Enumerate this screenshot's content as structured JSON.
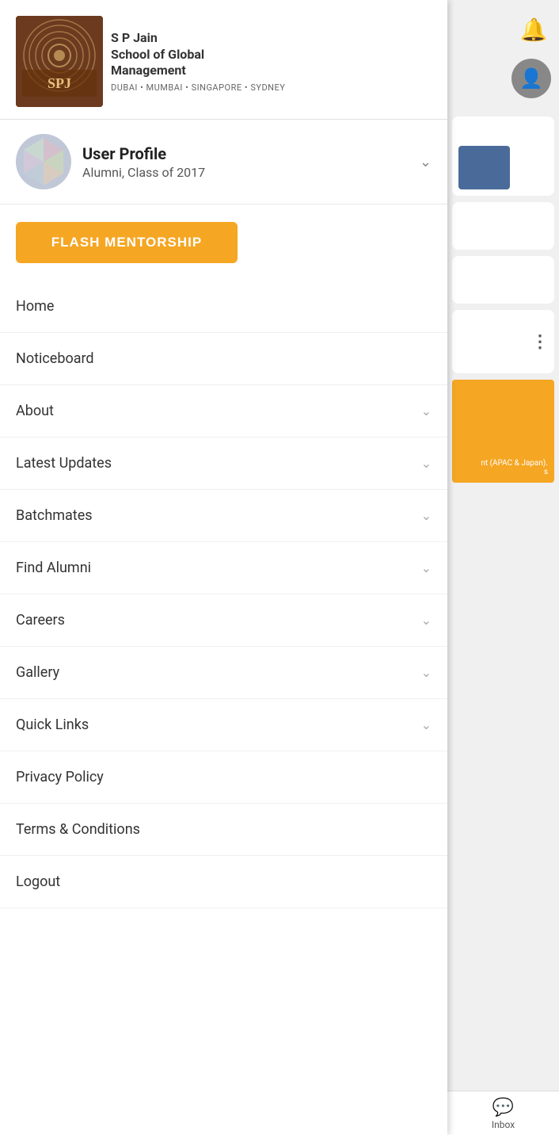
{
  "drawer": {
    "logo": {
      "school_name": "S P Jain",
      "school_sub": "School of Global",
      "school_sub2": "Management",
      "cities": "DUBAI • MUMBAI • SINGAPORE • SYDNEY",
      "spj_text": "SPJ"
    },
    "user_profile": {
      "name": "User Profile",
      "role": "Alumni, Class of 2017",
      "chevron": "›"
    },
    "flash_mentorship_btn": "FLASH MENTORSHIP",
    "nav_items": [
      {
        "label": "Home",
        "has_chevron": false
      },
      {
        "label": "Noticeboard",
        "has_chevron": false
      },
      {
        "label": "About",
        "has_chevron": true
      },
      {
        "label": "Latest Updates",
        "has_chevron": true
      },
      {
        "label": "Batchmates",
        "has_chevron": true
      },
      {
        "label": "Find Alumni",
        "has_chevron": true
      },
      {
        "label": "Careers",
        "has_chevron": true
      },
      {
        "label": "Gallery",
        "has_chevron": true
      },
      {
        "label": "Quick Links",
        "has_chevron": true
      }
    ],
    "bottom_links": [
      {
        "label": "Privacy Policy"
      },
      {
        "label": "Terms & Conditions"
      },
      {
        "label": "Logout"
      }
    ]
  },
  "right_panel": {
    "bell_icon": "🔔",
    "inbox_label": "Inbox"
  }
}
